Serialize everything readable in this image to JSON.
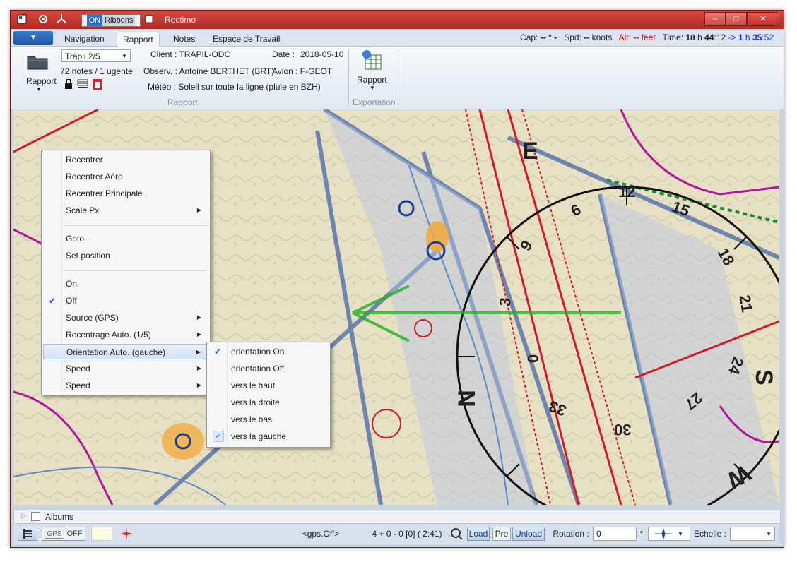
{
  "window": {
    "title": "Rectimo",
    "on_label": "ON",
    "ribbons_label": "Ribbons",
    "min": "–",
    "max": "□",
    "close": "✕"
  },
  "tabs": [
    {
      "label": "Navigation",
      "active": false
    },
    {
      "label": "Rapport",
      "active": true
    },
    {
      "label": "Notes",
      "active": false
    },
    {
      "label": "Espace de Travail",
      "active": false
    }
  ],
  "status_top": {
    "cap_label": "Cap:",
    "cap_value": "-- ° -",
    "spd_label": "Spd:",
    "spd_value": "--",
    "spd_unit": "knots",
    "alt_label": "Alt:",
    "alt_value": "--",
    "alt_unit": "feet",
    "time_label": "Time:",
    "time_h": "18",
    "time_m": "44",
    "time_s": "12",
    "h": "h",
    "colon": ":",
    "arrow": "->",
    "rem_h": "1",
    "rem_m": "35",
    "rem_s": "52"
  },
  "ribbon": {
    "rapport_btn": "Rapport",
    "trapil_combo": "Trapil 2/5",
    "notes_count": "72 notes / 1 ugente",
    "client": "Client : TRAPIL-ODC",
    "date_label": "Date :",
    "date_value": "2018-05-10",
    "observ": "Observ. : Antoine BERTHET (BRT)",
    "avion": "Avion : F-GEOT",
    "meteo": "Météo : Soleil sur toute la ligne (pluie en BZH)",
    "group_rapport": "Rapport",
    "export_btn": "Rapport",
    "group_export": "Exportation"
  },
  "context_menu": {
    "items": [
      {
        "label": "Recentrer",
        "sub": false,
        "checked": false
      },
      {
        "label": "Recentrer Aéro",
        "sub": false,
        "checked": false
      },
      {
        "label": "Recentrer Principale",
        "sub": false,
        "checked": false
      },
      {
        "label": "Scale Px",
        "sub": true,
        "checked": false
      },
      {
        "label": "Goto...",
        "sub": false,
        "checked": false
      },
      {
        "label": "Set position",
        "sub": false,
        "checked": false
      },
      {
        "label": "On",
        "sub": false,
        "checked": false
      },
      {
        "label": "Off",
        "sub": false,
        "checked": true
      },
      {
        "label": "Source (GPS)",
        "sub": true,
        "checked": false
      },
      {
        "label": "Recentrage Auto. (1/5)",
        "sub": true,
        "checked": false
      },
      {
        "label": "Orientation Auto. (gauche)",
        "sub": true,
        "checked": false,
        "highlight": true
      },
      {
        "label": "Speed",
        "sub": true,
        "checked": false
      },
      {
        "label": "Speed",
        "sub": true,
        "checked": false
      }
    ]
  },
  "submenu": {
    "items": [
      {
        "label": "orientation On",
        "checked": true
      },
      {
        "label": "orientation Off",
        "checked": false
      },
      {
        "label": "vers le haut",
        "checked": false
      },
      {
        "label": "vers la droite",
        "checked": false
      },
      {
        "label": "vers le bas",
        "checked": false
      },
      {
        "label": "vers la gauche",
        "checked": true,
        "box": true
      }
    ]
  },
  "compass": {
    "labels": [
      "12",
      "15",
      "18",
      "21",
      "24",
      "27",
      "30",
      "33",
      "3",
      "6",
      "9",
      "E",
      "S",
      "W",
      "N",
      "0"
    ]
  },
  "albums": {
    "label": "Albums"
  },
  "bottom": {
    "gps": "GPS",
    "off": "OFF",
    "gps_status": "<gps.Off>",
    "counter": "4 + 0 - 0 [0]  ( 2:41)",
    "load": "Load",
    "pre": "Pre",
    "unload": "Unload",
    "rotation_label": "Rotation :",
    "rotation_value": "0",
    "degree": "°",
    "echelle_label": "Echelle :"
  },
  "colors": {
    "title_red": "#c0302a",
    "accent_blue": "#2f6fbf",
    "annot_green": "#22b022"
  }
}
